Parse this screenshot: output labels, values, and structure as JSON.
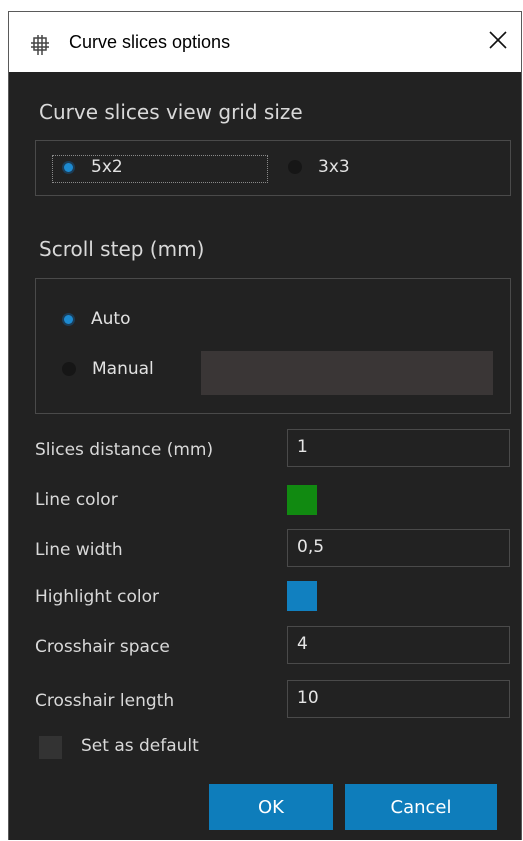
{
  "window": {
    "title": "Curve slices options"
  },
  "grid_size": {
    "title": "Curve slices view grid size",
    "options": [
      {
        "label": "5x2",
        "selected": true
      },
      {
        "label": "3x3",
        "selected": false
      }
    ]
  },
  "scroll_step": {
    "title": "Scroll step (mm)",
    "options": [
      {
        "label": "Auto",
        "selected": true
      },
      {
        "label": "Manual",
        "selected": false
      }
    ],
    "manual_value": ""
  },
  "settings": {
    "slices_distance": {
      "label": "Slices distance (mm)",
      "value": "1"
    },
    "line_color": {
      "label": "Line color",
      "color": "#118a11"
    },
    "line_width": {
      "label": "Line width",
      "value": "0,5"
    },
    "highlight_color": {
      "label": "Highlight color",
      "color": "#1180c0"
    },
    "crosshair_space": {
      "label": "Crosshair space",
      "value": "4"
    },
    "crosshair_length": {
      "label": "Crosshair length",
      "value": "10"
    }
  },
  "default_checkbox": {
    "label": "Set as default",
    "checked": false
  },
  "buttons": {
    "ok": "OK",
    "cancel": "Cancel"
  },
  "colors": {
    "accent": "#0e7dbb",
    "background": "#222222"
  }
}
